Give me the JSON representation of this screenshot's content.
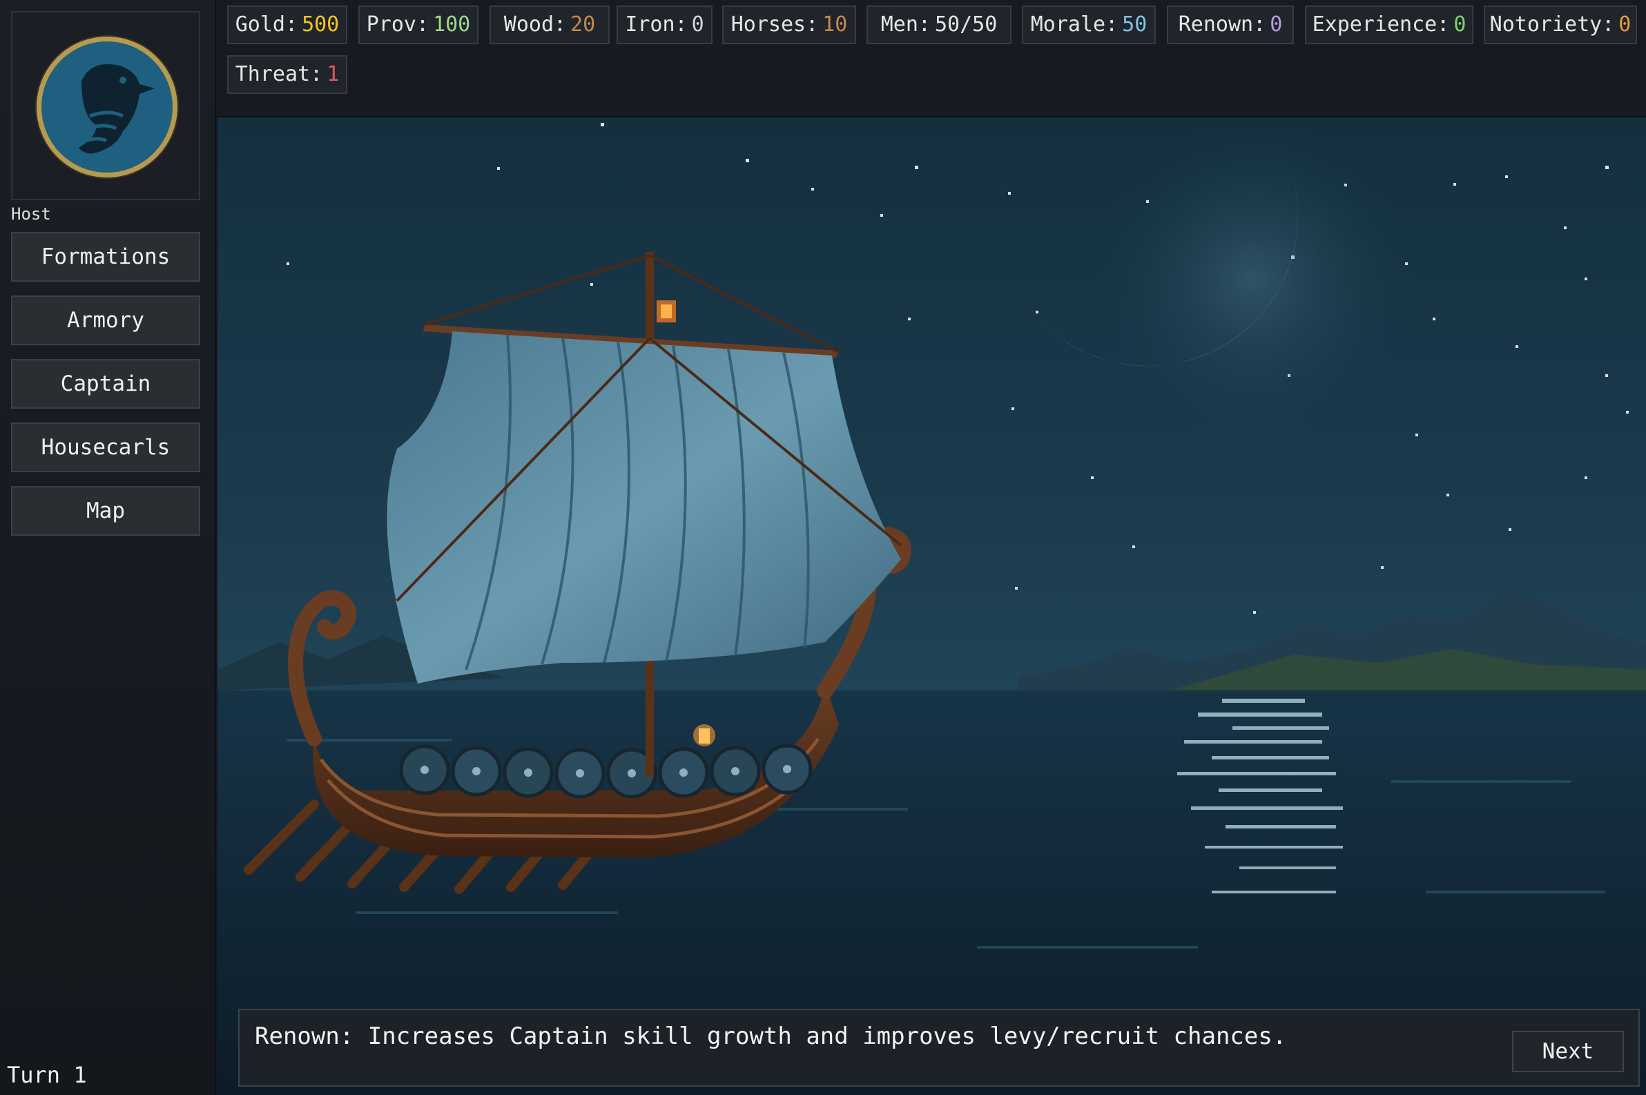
{
  "sidebar": {
    "host_label": "Host",
    "buttons": [
      {
        "label": "Formations"
      },
      {
        "label": "Armory"
      },
      {
        "label": "Captain"
      },
      {
        "label": "Housecarls"
      },
      {
        "label": "Map"
      }
    ],
    "turn_label": "Turn 1"
  },
  "logo": {
    "icon": "raven-emblem-icon",
    "ring_color": "#b79a52",
    "disc_color": "#1f5f7f"
  },
  "resources": [
    {
      "label": "Gold:",
      "value": "500",
      "color": "#f5c518"
    },
    {
      "label": "Prov:",
      "value": "100",
      "color": "#9fd88a"
    },
    {
      "label": "Wood:",
      "value": "20",
      "color": "#c48a4e"
    },
    {
      "label": "Iron:",
      "value": "0",
      "color": "#d0d4d8"
    },
    {
      "label": "Horses:",
      "value": "10",
      "color": "#c48a4e"
    },
    {
      "label": "Men:",
      "value": "50/50",
      "color": "#e6e6e6"
    },
    {
      "label": "Morale:",
      "value": "50",
      "color": "#7cc4e8"
    },
    {
      "label": "Renown:",
      "value": "0",
      "color": "#b59be0"
    },
    {
      "label": "Experience:",
      "value": "0",
      "color": "#7ed46a"
    },
    {
      "label": "Notoriety:",
      "value": "0",
      "color": "#e89a3c"
    },
    {
      "label": "Threat:",
      "value": "1",
      "color": "#e05858"
    }
  ],
  "dialog": {
    "text": "Renown: Increases Captain skill growth and improves levy/recruit chances.",
    "next_label": "Next"
  },
  "scene": {
    "description_icon": "longship-moonlit-sea-scene"
  }
}
